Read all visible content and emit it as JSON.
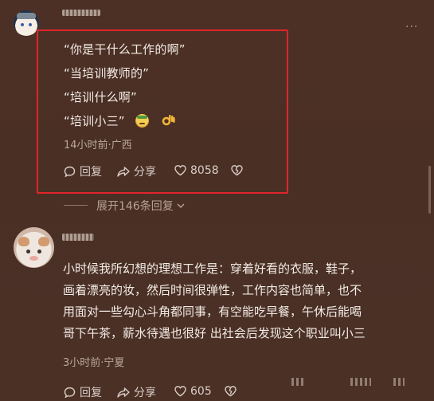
{
  "comment1": {
    "lines": [
      "“你是干什么工作的啊”",
      "“当培训教师的”",
      "“培训什么啊”",
      "“培训小三”"
    ],
    "meta": "14小时前·广西",
    "actions": {
      "reply_label": "回复",
      "share_label": "分享",
      "like_count": "8058"
    },
    "emojis": [
      "smirk-emoji",
      "ok-hand-emoji"
    ]
  },
  "expand_replies_label": "展开146条回复",
  "comment2": {
    "lines": [
      "小时候我所幻想的理想工作是：穿着好看的衣服，鞋子，",
      "画着漂亮的妆，然后时间很弹性，工作内容也简单，也不",
      "用面对一些勾心斗角都同事，有空能吃早餐，午休后能喝",
      "哥下午茶，薪水待遇也很好 出社会后发现这个职业叫小三"
    ],
    "meta": "3小时前·宁夏",
    "actions": {
      "reply_label": "回复",
      "share_label": "分享",
      "like_count": "605"
    }
  },
  "colors": {
    "background": "#4b3026",
    "highlight_border": "#e0252a",
    "text": "#f3ece6",
    "meta": "#b9a79d"
  }
}
